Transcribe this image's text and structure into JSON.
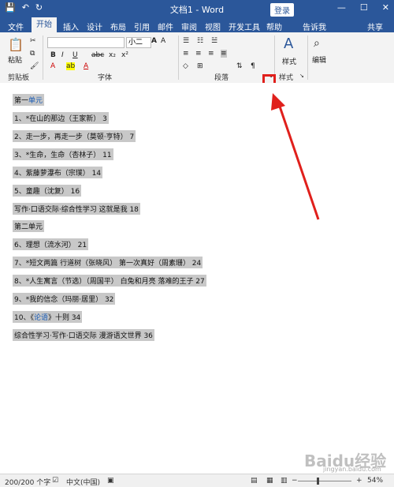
{
  "title_bar": {
    "doc_title": "文档1 - Word",
    "login": "登录",
    "minimize": "—",
    "maximize": "☐",
    "close": "✕",
    "save_glyph": "💾",
    "undo_glyph": "↶",
    "redo_glyph": "↻"
  },
  "tabs": [
    "文件",
    "开始",
    "插入",
    "设计",
    "布局",
    "引用",
    "邮件",
    "审阅",
    "视图",
    "开发工具",
    "帮助",
    "告诉我",
    "共享"
  ],
  "ribbon": {
    "paste": "粘贴",
    "font_size": "小二",
    "clipboard_label": "剪贴板",
    "font_label": "字体",
    "paragraph_label": "段落",
    "styles_label": "样式",
    "styles_button": "样式",
    "edit_button": "编辑"
  },
  "document_lines": [
    {
      "text": "第一",
      "link": "单元"
    },
    {
      "text": "1、*在山的那边（王家新）   3"
    },
    {
      "text": "2、走一步，再走一步（莫顿·亨特）   7"
    },
    {
      "text": "3、*生命，生命（杏林子）   11"
    },
    {
      "text": "4、紫藤萝瀑布（宗璞）   14"
    },
    {
      "text": "5、童趣（沈复）   16"
    },
    {
      "text": "写作·口语交际·综合性学习  这就是我   18"
    },
    {
      "text": "第二单元"
    },
    {
      "text": "6、理想（流水河）   21"
    },
    {
      "text": "7、*短文两篇  行道树（张晓风）  第一次真好（周素珊）   24"
    },
    {
      "text": "8、*人生寓言（节选）（周国平）  白兔和月亮  落难的王子   27"
    },
    {
      "text": "9、*我的信念（玛丽·居里）   32"
    },
    {
      "text": "10、《",
      "link": "论语",
      "suffix": "》十则   34"
    },
    {
      "text": "综合性学习·写作·口语交际  漫游语文世界   36"
    }
  ],
  "status": {
    "words": "200/200 个字",
    "lang": "中文(中国)",
    "zoom": "54%"
  },
  "watermark": {
    "main": "Baidu经验",
    "sub": "jingyan.baidu.com"
  }
}
